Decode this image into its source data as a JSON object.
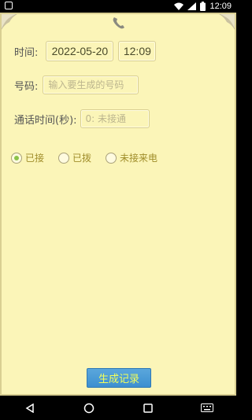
{
  "status_bar": {
    "time": "12:09"
  },
  "form": {
    "time_label": "时间:",
    "date_value": "2022-05-20",
    "time_value": "12:09",
    "number_label": "号码:",
    "number_placeholder": "输入要生成的号码",
    "duration_label": "通话时间(秒):",
    "duration_placeholder": "0: 未接通"
  },
  "call_types": [
    {
      "label": "已接",
      "checked": true
    },
    {
      "label": "已拨",
      "checked": false
    },
    {
      "label": "未接来电",
      "checked": false
    }
  ],
  "generate_button": "生成记录",
  "colors": {
    "background": "#fbf5b8",
    "border": "#d9cf92",
    "button": "#4a9bd6",
    "button_text": "#f3ff5a",
    "radio_checked": "#8bc34a"
  }
}
